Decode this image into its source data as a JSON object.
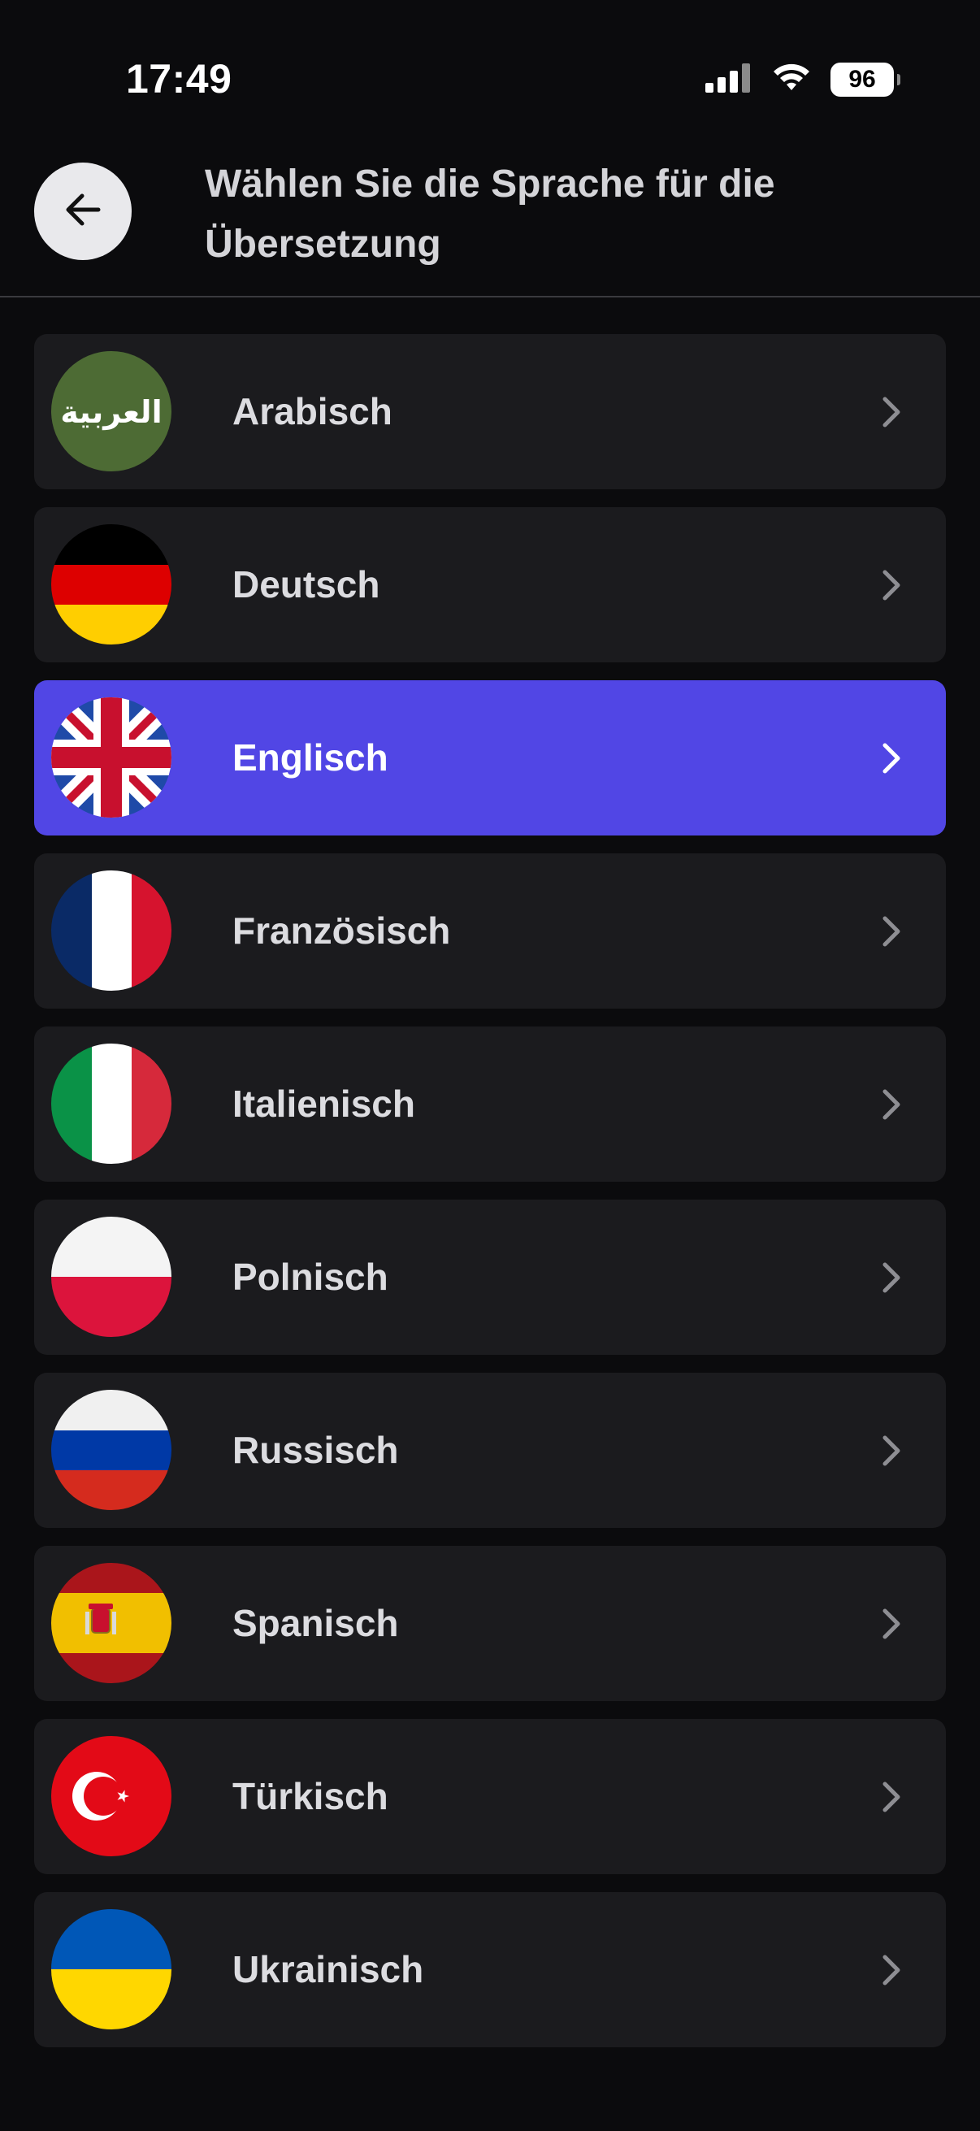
{
  "status_bar": {
    "time": "17:49",
    "battery_level": "96",
    "icons": [
      "signal-icon",
      "wifi-icon",
      "battery-icon"
    ]
  },
  "header": {
    "back_icon": "arrow-left-icon",
    "title": "Wählen Sie die Sprache für die Übersetzung"
  },
  "colors": {
    "background": "#0b0b0d",
    "row_background": "#1b1b1e",
    "selected_row": "#5146e5",
    "text": "#dcdce0"
  },
  "languages": [
    {
      "label": "Arabisch",
      "flag": "arabic-script-flag-icon",
      "flag_text": "العربية",
      "selected": false
    },
    {
      "label": "Deutsch",
      "flag": "germany-flag-icon",
      "selected": false
    },
    {
      "label": "Englisch",
      "flag": "uk-flag-icon",
      "selected": true
    },
    {
      "label": "Französisch",
      "flag": "france-flag-icon",
      "selected": false
    },
    {
      "label": "Italienisch",
      "flag": "italy-flag-icon",
      "selected": false
    },
    {
      "label": "Polnisch",
      "flag": "poland-flag-icon",
      "selected": false
    },
    {
      "label": "Russisch",
      "flag": "russia-flag-icon",
      "selected": false
    },
    {
      "label": "Spanisch",
      "flag": "spain-flag-icon",
      "selected": false
    },
    {
      "label": "Türkisch",
      "flag": "turkey-flag-icon",
      "selected": false
    },
    {
      "label": "Ukrainisch",
      "flag": "ukraine-flag-icon",
      "selected": false
    }
  ]
}
